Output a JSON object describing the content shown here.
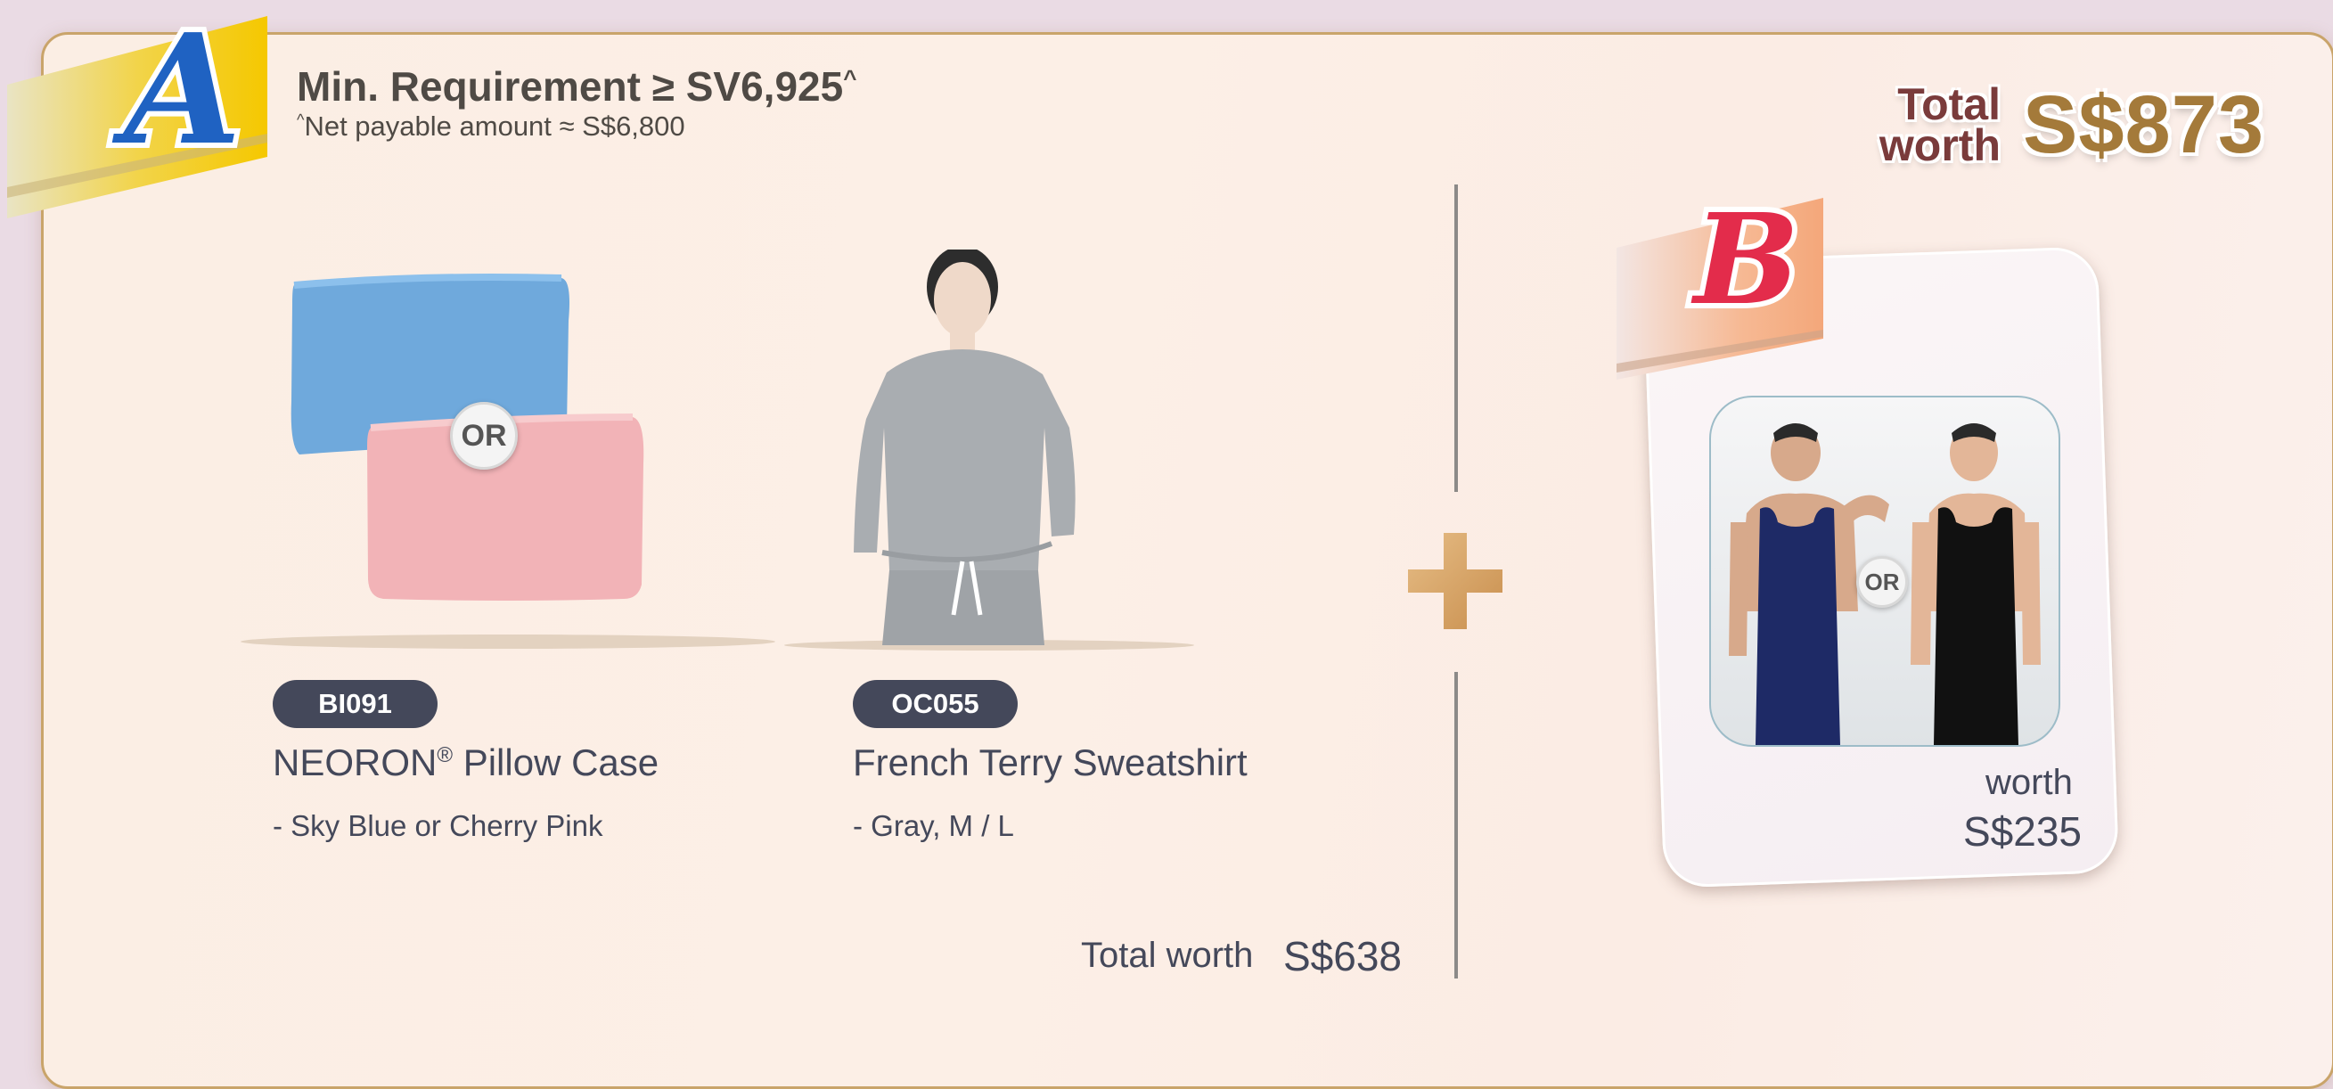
{
  "requirement": {
    "badge_letter": "A",
    "title": "Min. Requirement ≥ SV6,925",
    "title_mark": "^",
    "note_mark": "^",
    "note": "Net payable amount ≈ S$6,800"
  },
  "total_worth": {
    "label_line1": "Total",
    "label_line2": "worth",
    "amount": "S$873"
  },
  "products": [
    {
      "code": "BI091",
      "name": "NEORON",
      "name_mark": "®",
      "name_rest": " Pillow Case",
      "variant": "- Sky Blue or Cherry Pink",
      "colors": [
        "#6fa9dc",
        "#f2b3b7"
      ]
    },
    {
      "code": "OC055",
      "name": "French Terry Sweatshirt",
      "variant": "- Gray, M / L",
      "colors": [
        "#a9adb1"
      ]
    }
  ],
  "or_label": "OR",
  "subtotal": {
    "label": "Total worth",
    "amount": "S$638"
  },
  "gift_b": {
    "badge_letter": "B",
    "worth_label": "worth",
    "amount": "S$235",
    "colors": [
      "#1e2a66",
      "#111111"
    ]
  }
}
